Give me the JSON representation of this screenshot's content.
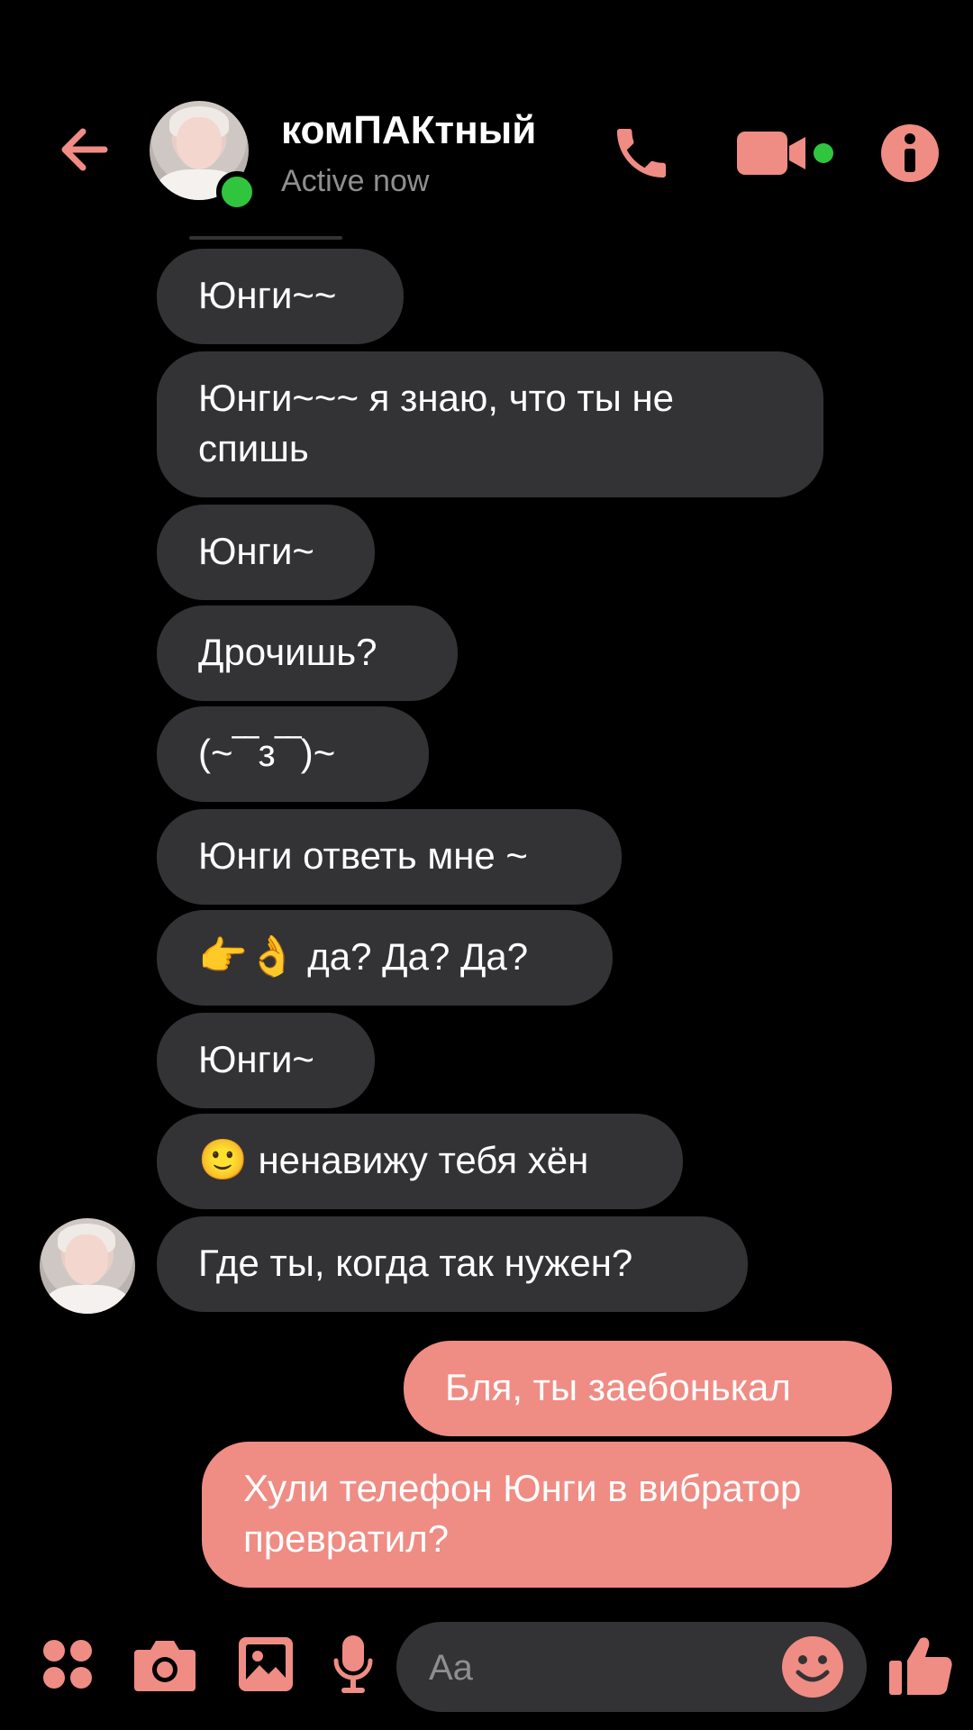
{
  "colors": {
    "accent": "#ef8c84",
    "incoming_bubble": "#333335",
    "online": "#31c53d",
    "background": "#000000"
  },
  "header": {
    "contact_name": "комПАКтный",
    "status": "Active now",
    "icons": [
      "back-arrow-icon",
      "phone-icon",
      "video-camera-icon",
      "info-icon"
    ]
  },
  "messages": [
    {
      "direction": "in",
      "text": "Юнги~~"
    },
    {
      "direction": "in",
      "text": "Юнги~~~ я знаю, что ты не спишь"
    },
    {
      "direction": "in",
      "text": "Юнги~"
    },
    {
      "direction": "in",
      "text": "Дрочишь?"
    },
    {
      "direction": "in",
      "text": "(~‾‾з‾‾)~"
    },
    {
      "direction": "in",
      "text": "Юнги ответь мне ~"
    },
    {
      "direction": "in",
      "emoji": "👉👌",
      "text": " да? Да? Да?"
    },
    {
      "direction": "in",
      "text": "Юнги~"
    },
    {
      "direction": "in",
      "emoji": "🙂",
      "text": " ненавижу тебя хён"
    },
    {
      "direction": "in",
      "text": "Где ты, когда так нужен?"
    },
    {
      "direction": "out",
      "text": "Бля, ты заебонькал"
    },
    {
      "direction": "out",
      "text": "Хули телефон Юнги в вибратор превратил?"
    }
  ],
  "composer": {
    "placeholder": "Aa",
    "icons": [
      "menu-dots-icon",
      "camera-icon",
      "gallery-icon",
      "microphone-icon",
      "emoji-icon",
      "thumbs-up-icon"
    ]
  }
}
